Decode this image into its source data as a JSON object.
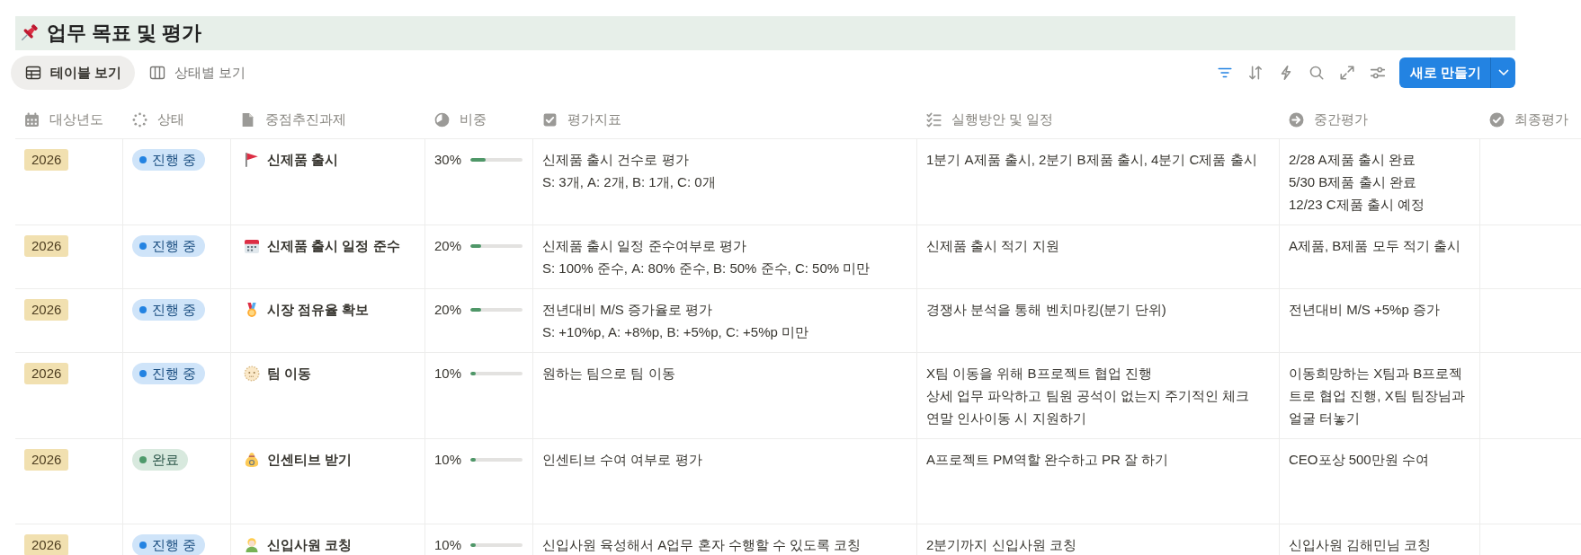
{
  "title": "업무 목표 및 평가",
  "views": [
    {
      "label": "테이블 보기",
      "kind": "table",
      "selected": true
    },
    {
      "label": "상태별 보기",
      "kind": "board",
      "selected": false
    }
  ],
  "toolbar": [
    {
      "kind": "filter",
      "active": true
    },
    {
      "kind": "sort",
      "active": false
    },
    {
      "kind": "automation",
      "active": false
    },
    {
      "kind": "search",
      "active": false
    },
    {
      "kind": "expand",
      "active": false
    },
    {
      "kind": "settings",
      "active": false
    }
  ],
  "new_button": {
    "label": "새로 만들기"
  },
  "table": {
    "columns": [
      {
        "label": "대상년도",
        "kind": "date"
      },
      {
        "label": "상태",
        "kind": "status"
      },
      {
        "label": "중점추진과제",
        "kind": "page"
      },
      {
        "label": "비중",
        "kind": "ratio"
      },
      {
        "label": "평가지표",
        "kind": "checkbox"
      },
      {
        "label": "실행방안 및 일정",
        "kind": "checklist"
      },
      {
        "label": "중간평가",
        "kind": "arrow"
      },
      {
        "label": "최종평가",
        "kind": "done"
      }
    ],
    "rows": [
      {
        "year": "2026",
        "status": {
          "label": "진행 중",
          "color": "#2383e2"
        },
        "task": {
          "kind": "flag",
          "text": "신제품 출시"
        },
        "weight": {
          "reading": "30%",
          "level": 0.3
        },
        "metric": [
          "신제품 출시 건수로 평가",
          "S: 3개, A: 2개, B: 1개, C: 0개"
        ],
        "plan": [
          "1분기 A제품 출시, 2분기 B제품 출시, 4분기 C제품 출시"
        ],
        "midterm": [
          "2/28 A제품 출시 완료",
          "5/30 B제품 출시 완료",
          "12/23 C제품 출시 예정"
        ]
      },
      {
        "year": "2026",
        "status": {
          "label": "진행 중",
          "color": "#2383e2"
        },
        "task": {
          "kind": "calendar",
          "text": "신제품 출시 일정 준수"
        },
        "weight": {
          "reading": "20%",
          "level": 0.2
        },
        "metric": [
          "신제품 출시 일정 준수여부로 평가",
          "S: 100% 준수, A: 80% 준수, B: 50% 준수, C: 50% 미만"
        ],
        "plan": [
          "신제품 출시 적기 지원"
        ],
        "midterm": [
          "A제품, B제품 모두 적기 출시"
        ]
      },
      {
        "year": "2026",
        "status": {
          "label": "진행 중",
          "color": "#2383e2"
        },
        "task": {
          "kind": "medal",
          "text": "시장 점유율 확보"
        },
        "weight": {
          "reading": "20%",
          "level": 0.2
        },
        "metric": [
          "전년대비 M/S 증가율로 평가",
          "S: +10%p, A: +8%p, B: +5%p, C: +5%p 미만"
        ],
        "plan": [
          "경쟁사 분석을 통해 벤치마킹(분기 단위)"
        ],
        "midterm": [
          "전년대비 M/S +5%p 증가"
        ]
      },
      {
        "year": "2026",
        "status": {
          "label": "진행 중",
          "color": "#2383e2"
        },
        "task": {
          "kind": "face",
          "text": "팀 이동"
        },
        "weight": {
          "reading": "10%",
          "level": 0.1
        },
        "metric": [
          "원하는 팀으로 팀 이동"
        ],
        "plan": [
          "X팀 이동을 위해 B프로젝트 협업 진행",
          "상세 업무 파악하고 팀원 공석이 없는지 주기적인 체크",
          "연말 인사이동 시 지원하기"
        ],
        "midterm": [
          "이동희망하는 X팀과 B프로젝트로 협업 진행, X팀 팀장님과 얼굴 터놓기"
        ]
      },
      {
        "year": "2026",
        "status": {
          "label": "완료",
          "color": "#4e9a6b"
        },
        "task": {
          "kind": "moneybag",
          "text": "인센티브 받기"
        },
        "weight": {
          "reading": "10%",
          "level": 0.1
        },
        "metric": [
          "인센티브 수여 여부로 평가"
        ],
        "plan": [
          "A프로젝트 PM역할 완수하고 PR 잘 하기"
        ],
        "midterm": [
          "CEO포상 500만원 수여"
        ]
      },
      {
        "year": "2026",
        "status": {
          "label": "진행 중",
          "color": "#2383e2"
        },
        "task": {
          "kind": "person",
          "text": "신입사원 코칭"
        },
        "weight": {
          "reading": "10%",
          "level": 0.1
        },
        "metric": [
          "신입사원 육성해서 A업무 혼자 수행할 수 있도록 코칭"
        ],
        "plan": [
          "2분기까지 신입사원 코칭"
        ],
        "midterm": [
          "신입사원 김해민님 코칭"
        ]
      }
    ]
  }
}
